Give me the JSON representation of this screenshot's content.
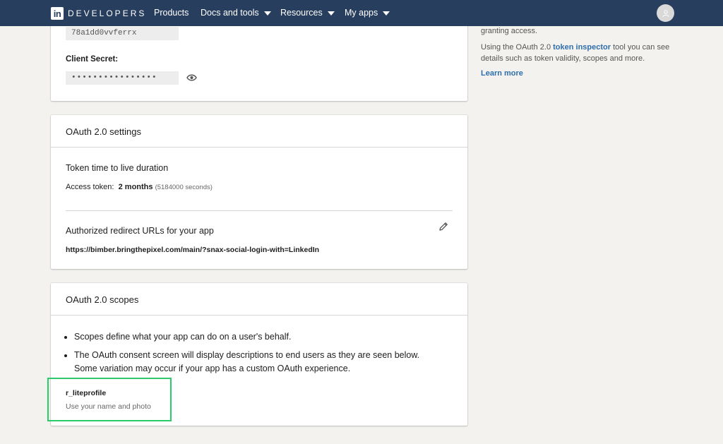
{
  "nav": {
    "logo": "in",
    "brand": "DEVELOPERS",
    "items": [
      {
        "label": "Products",
        "dropdown": false
      },
      {
        "label": "Docs and tools",
        "dropdown": true
      },
      {
        "label": "Resources",
        "dropdown": true
      },
      {
        "label": "My apps",
        "dropdown": true
      }
    ],
    "avatar_icon": "user-icon"
  },
  "credentials": {
    "client_id_value": "78a1dd0vvferrx",
    "client_secret_label": "Client Secret:",
    "client_secret_value": "••••••••••••••••",
    "reveal_icon": "eye-icon"
  },
  "oauth_settings": {
    "title": "OAuth 2.0 settings",
    "token_section_title": "Token time to live duration",
    "access_token_label": "Access token:",
    "access_token_value": "2 months",
    "access_token_seconds": "(5184000 seconds)",
    "redirect_title": "Authorized redirect URLs for your app",
    "redirect_url": "https://bimber.bringthepixel.com/main/?snax-social-login-with=LinkedIn",
    "edit_icon": "pencil-icon"
  },
  "oauth_scopes": {
    "title": "OAuth 2.0 scopes",
    "bullets": [
      "Scopes define what your app can do on a user's behalf.",
      "The OAuth consent screen will display descriptions to end users as they are seen below. Some variation may occur if your app has a custom OAuth experience."
    ],
    "scope_name": "r_liteprofile",
    "scope_desc": "Use your name and photo"
  },
  "sidebar": {
    "line1": "granting access.",
    "inspector_prefix": "Using the OAuth 2.0 ",
    "inspector_link": "token inspector",
    "inspector_suffix": " tool you can see details such as token validity, scopes and more.",
    "learn_more": "Learn more"
  },
  "colors": {
    "nav_bg": "#283e5e",
    "page_bg": "#f3f2ef",
    "link": "#2f6ead",
    "highlight": "#2ccb6a"
  }
}
